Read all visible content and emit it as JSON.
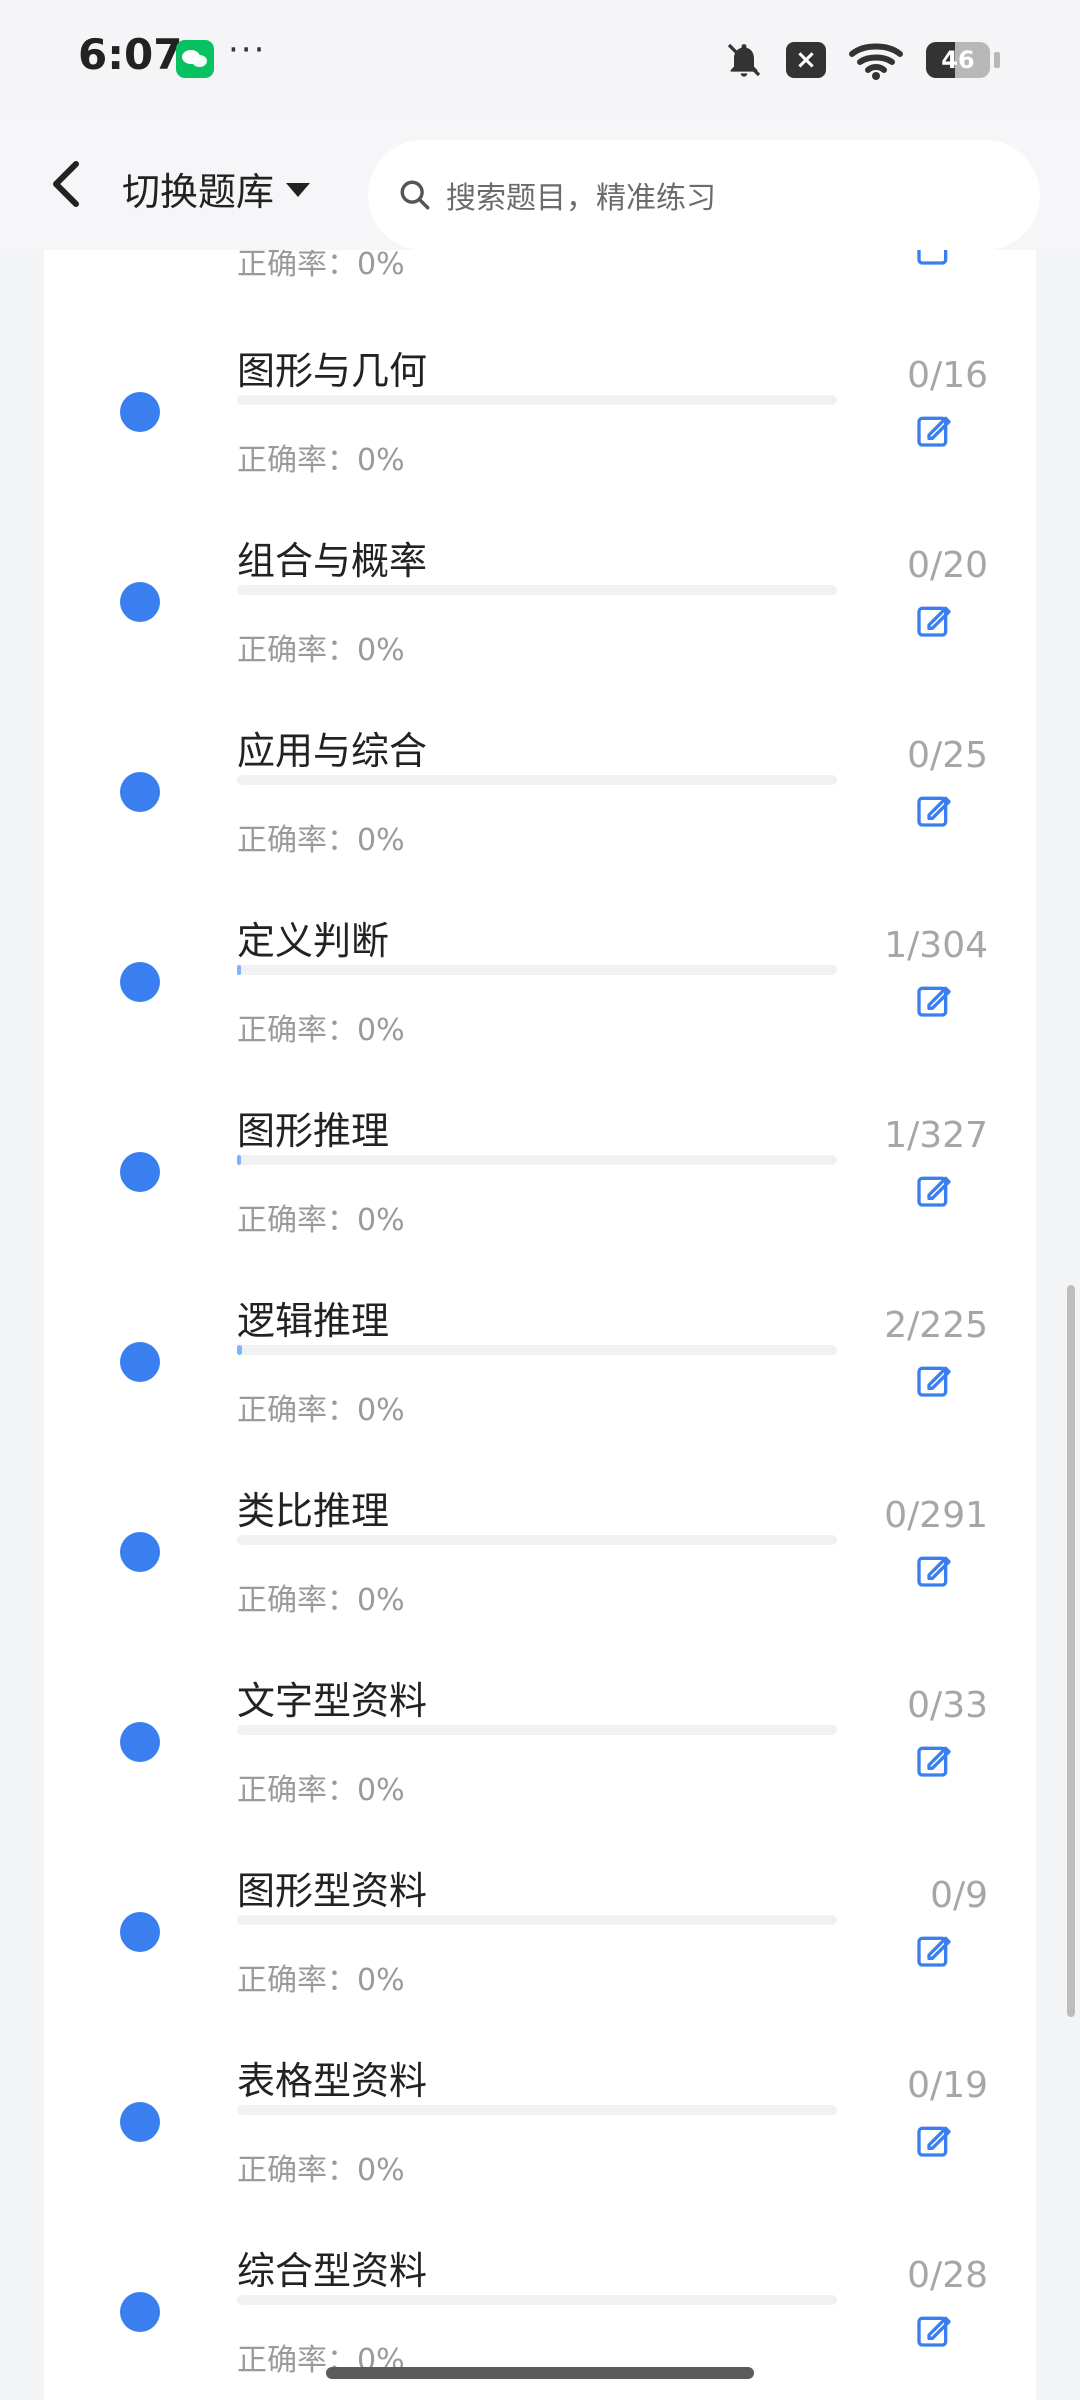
{
  "status_bar": {
    "time": "6:07",
    "dots": "···",
    "x_badge": "×",
    "battery_level": "46",
    "icons": [
      "wechat-icon",
      "mute-bell-icon",
      "x-icon",
      "wifi-icon",
      "battery-icon"
    ]
  },
  "header": {
    "switch_label": "切换题库",
    "search_placeholder": "搜索题目，精准练习",
    "icons": [
      "back-arrow-icon",
      "caret-down-icon",
      "search-icon"
    ]
  },
  "partial_item": {
    "accuracy_label": "正确率：0%"
  },
  "items": [
    {
      "title": "图形与几何",
      "count": "0/16",
      "accuracy_label": "正确率：0%",
      "progress": 0
    },
    {
      "title": "组合与概率",
      "count": "0/20",
      "accuracy_label": "正确率：0%",
      "progress": 0
    },
    {
      "title": "应用与综合",
      "count": "0/25",
      "accuracy_label": "正确率：0%",
      "progress": 0
    },
    {
      "title": "定义判断",
      "count": "1/304",
      "accuracy_label": "正确率：0%",
      "progress": 0.00329
    },
    {
      "title": "图形推理",
      "count": "1/327",
      "accuracy_label": "正确率：0%",
      "progress": 0.00306
    },
    {
      "title": "逻辑推理",
      "count": "2/225",
      "accuracy_label": "正确率：0%",
      "progress": 0.00889
    },
    {
      "title": "类比推理",
      "count": "0/291",
      "accuracy_label": "正确率：0%",
      "progress": 0
    },
    {
      "title": "文字型资料",
      "count": "0/33",
      "accuracy_label": "正确率：0%",
      "progress": 0
    },
    {
      "title": "图形型资料",
      "count": "0/9",
      "accuracy_label": "正确率：0%",
      "progress": 0
    },
    {
      "title": "表格型资料",
      "count": "0/19",
      "accuracy_label": "正确率：0%",
      "progress": 0
    },
    {
      "title": "综合型资料",
      "count": "0/28",
      "accuracy_label": "正确率：0%",
      "progress": 0
    }
  ],
  "colors": {
    "accent": "#3a7ff0",
    "progress_fill": "#7fb2ff",
    "muted_text": "#9a9a9a",
    "count_text": "#a6a6a6"
  }
}
